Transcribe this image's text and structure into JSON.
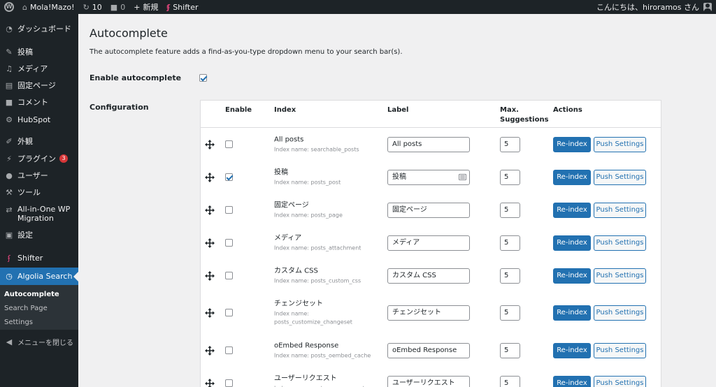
{
  "adminbar": {
    "site_name": "Mola!Mazo!",
    "updates_count": "10",
    "comments_count": "0",
    "new_label": "新規",
    "shifter_label": "Shifter",
    "greeting": "こんにちは、hiroramos さん"
  },
  "sidebar": {
    "items": [
      {
        "label": "ダッシュボード",
        "icon": "dashboard-icon"
      },
      {
        "label": "投稿",
        "icon": "pin-icon"
      },
      {
        "label": "メディア",
        "icon": "media-icon"
      },
      {
        "label": "固定ページ",
        "icon": "page-icon"
      },
      {
        "label": "コメント",
        "icon": "comment-icon"
      },
      {
        "label": "HubSpot",
        "icon": "hubspot-icon"
      },
      {
        "label": "外観",
        "icon": "brush-icon"
      },
      {
        "label": "プラグイン",
        "icon": "plugin-icon",
        "badge": "3"
      },
      {
        "label": "ユーザー",
        "icon": "user-icon"
      },
      {
        "label": "ツール",
        "icon": "wrench-icon"
      },
      {
        "label": "All-in-One WP Migration",
        "icon": "migration-icon"
      },
      {
        "label": "設定",
        "icon": "settings-icon"
      },
      {
        "label": "Shifter",
        "icon": "shifter-icon"
      },
      {
        "label": "Algolia Search",
        "icon": "algolia-icon"
      }
    ],
    "submenu": [
      "Autocomplete",
      "Search Page",
      "Settings"
    ],
    "collapse_label": "メニューを閉じる"
  },
  "page": {
    "title": "Autocomplete",
    "description": "The autocomplete feature adds a find-as-you-type dropdown menu to your search bar(s).",
    "enable_label": "Enable autocomplete",
    "enable_checked": true,
    "config_label": "Configuration"
  },
  "table": {
    "headers": {
      "enable": "Enable",
      "index": "Index",
      "label": "Label",
      "max_line1": "Max.",
      "max_line2": "Suggestions",
      "actions": "Actions"
    },
    "rows": [
      {
        "name": "All posts",
        "sub": "Index name: searchable_posts",
        "label": "All posts",
        "max": "5",
        "enabled": false
      },
      {
        "name": "投稿",
        "sub": "Index name: posts_post",
        "label": "投稿",
        "max": "5",
        "enabled": true
      },
      {
        "name": "固定ページ",
        "sub": "Index name: posts_page",
        "label": "固定ページ",
        "max": "5",
        "enabled": false
      },
      {
        "name": "メディア",
        "sub": "Index name: posts_attachment",
        "label": "メディア",
        "max": "5",
        "enabled": false
      },
      {
        "name": "カスタム CSS",
        "sub": "Index name: posts_custom_css",
        "label": "カスタム CSS",
        "max": "5",
        "enabled": false
      },
      {
        "name": "チェンジセット",
        "sub": "Index name: posts_customize_changeset",
        "label": "チェンジセット",
        "max": "5",
        "enabled": false
      },
      {
        "name": "oEmbed Response",
        "sub": "Index name: posts_oembed_cache",
        "label": "oEmbed Response",
        "max": "5",
        "enabled": false
      },
      {
        "name": "ユーザーリクエスト",
        "sub": "Index name: posts_user_request",
        "label": "ユーザーリクエスト",
        "max": "5",
        "enabled": false
      }
    ],
    "reindex_label": "Re-index",
    "push_label": "Push Settings"
  },
  "colors": {
    "accent": "#2271b1",
    "adminbar": "#1d2327",
    "badge": "#d63638"
  }
}
